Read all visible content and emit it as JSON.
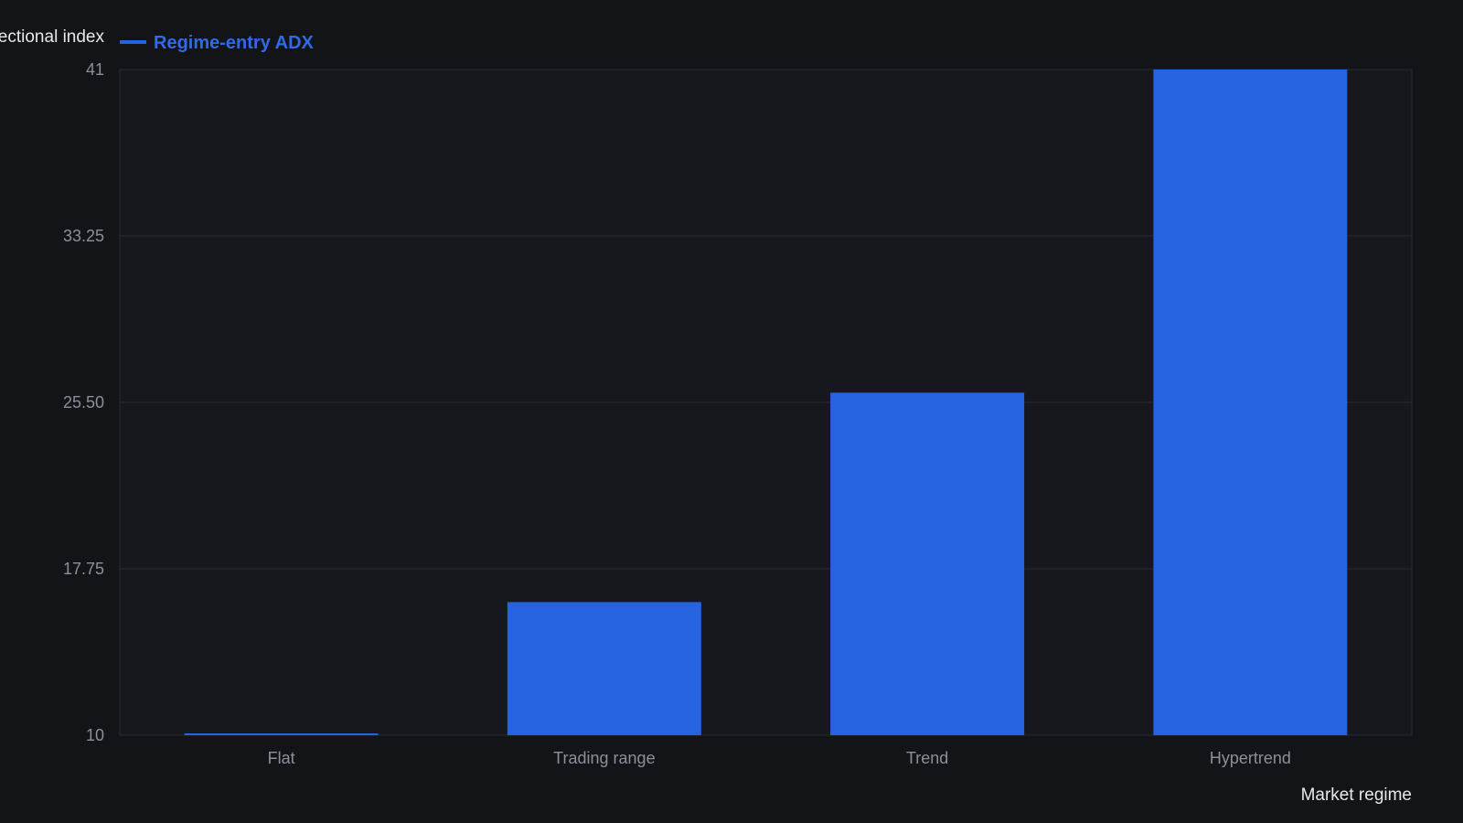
{
  "chart_data": {
    "type": "bar",
    "categories": [
      "Flat",
      "Trading range",
      "Trend",
      "Hypertrend"
    ],
    "series": [
      {
        "name": "Regime-entry ADX",
        "values": [
          10,
          16.2,
          25.95,
          41
        ],
        "color": "#2563e0"
      }
    ],
    "ylabel": "Average directional index",
    "xlabel": "Market regime",
    "ylim": [
      10,
      41
    ],
    "yticks": [
      "10",
      "17.75",
      "25.50",
      "33.25",
      "41"
    ],
    "grid": true,
    "legend": "top-left"
  },
  "colors": {
    "background": "#121418",
    "plot_background": "#16181d",
    "grid": "#262a31",
    "accent": "#2563e0",
    "legend_text": "#2f6be8"
  }
}
